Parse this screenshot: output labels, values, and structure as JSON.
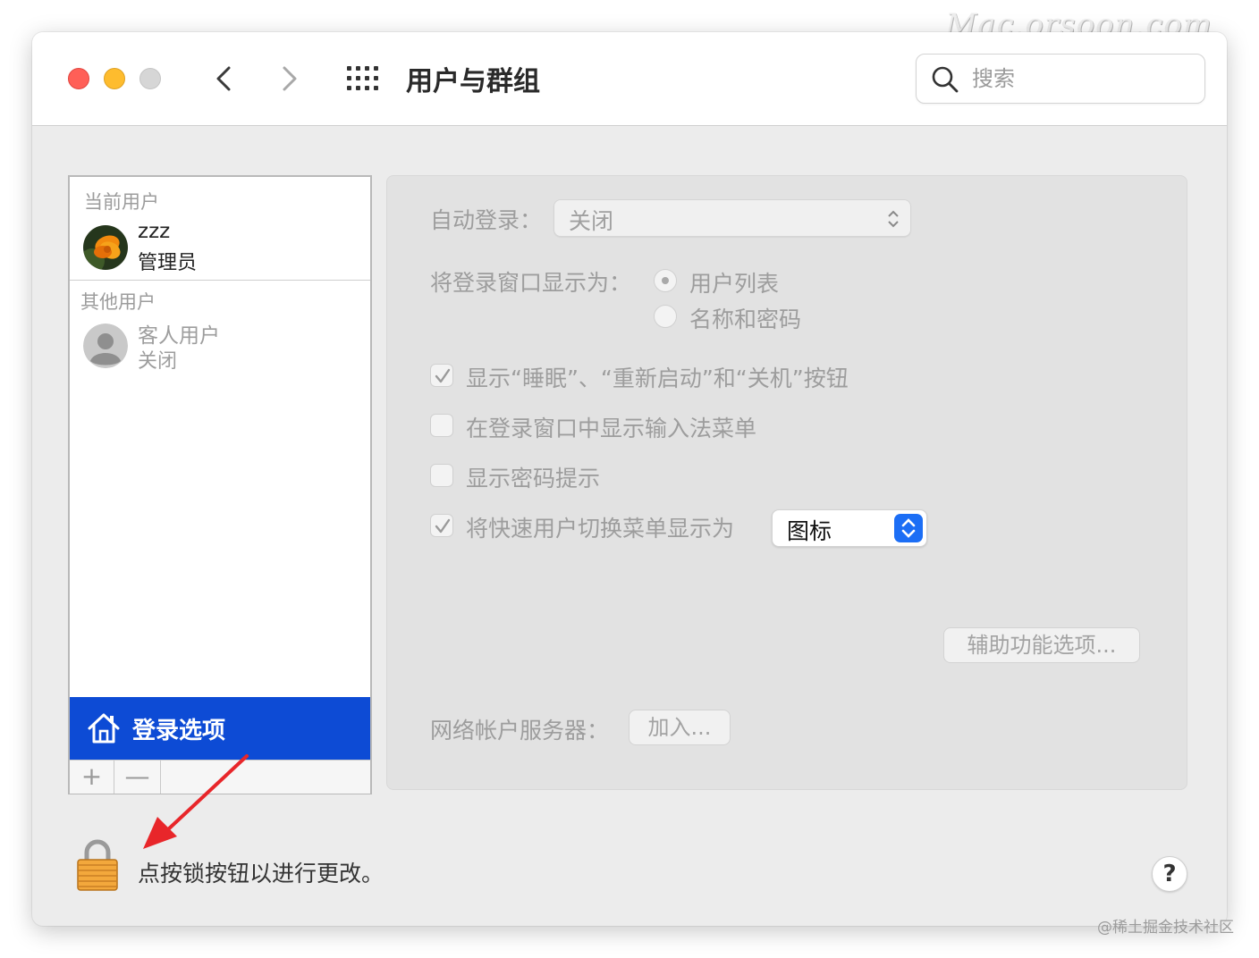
{
  "watermark": "Mac.orsoon.com",
  "credit": "@稀土掘金技术社区",
  "window": {
    "title": "用户与群组"
  },
  "search": {
    "placeholder": "搜索"
  },
  "user_list": {
    "current_header": "当前用户",
    "current_user": {
      "name": "zzz",
      "role": "管理员"
    },
    "other_header": "其他用户",
    "guest_user": {
      "name": "客人用户",
      "status": "关闭"
    },
    "login_options_label": "登录选项",
    "add_label": "+",
    "remove_label": "—"
  },
  "settings": {
    "auto_login_label": "自动登录：",
    "auto_login_value": "关闭",
    "display_login_window_label": "将登录窗口显示为：",
    "radio_user_list": "用户列表",
    "radio_name_password": "名称和密码",
    "radio_selected": "用户列表",
    "check_show_buttons": {
      "label": "显示“睡眠”、“重新启动”和“关机”按钮",
      "checked": true
    },
    "check_input_menu": {
      "label": "在登录窗口中显示输入法菜单",
      "checked": false
    },
    "check_password_hints": {
      "label": "显示密码提示",
      "checked": false
    },
    "check_fast_switch": {
      "label": "将快速用户切换菜单显示为",
      "checked": true
    },
    "fast_switch_value": "图标",
    "accessibility_button": "辅助功能选项...",
    "network_server_label": "网络帐户服务器：",
    "join_button": "加入..."
  },
  "footer": {
    "lock_text": "点按锁按钮以进行更改。",
    "help_label": "?"
  },
  "colors": {
    "selection": "#0d4bd5",
    "accent": "#1c6ef5",
    "annotation_arrow": "#e8262a"
  }
}
